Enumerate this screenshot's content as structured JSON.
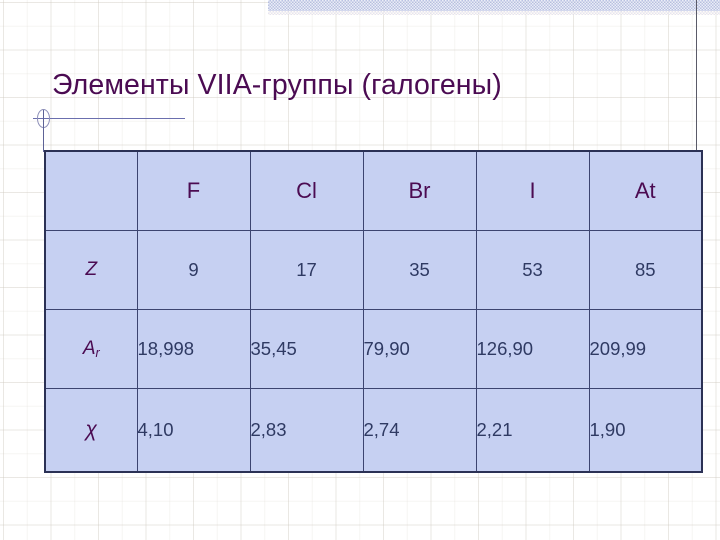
{
  "slide": {
    "title": "Элементы VIIA-группы (галогены)",
    "title_color": "#4b0b52",
    "background": "graph-paper",
    "accent_table_fill": "#c6d0f2",
    "accent_table_border": "#2b3155"
  },
  "decorations": {
    "circle_bullet": "circle-outline-bullet",
    "horizontal_rule": "title-underline-rule",
    "vertical_rule": "connector-rule",
    "top_band": "dithered-band",
    "right_rule": "right-vertical-rule"
  },
  "table": {
    "columns": [
      "",
      "F",
      "Cl",
      "Br",
      "I",
      "At"
    ],
    "rows": [
      {
        "label": "Z",
        "label_sub": "",
        "align": "center",
        "values": [
          "9",
          "17",
          "35",
          "53",
          "85"
        ]
      },
      {
        "label": "A",
        "label_sub": "r",
        "align": "left",
        "values": [
          "18,998",
          "35,45",
          "79,90",
          "126,90",
          "209,99"
        ]
      },
      {
        "label": "χ",
        "label_sub": "",
        "align": "left",
        "values": [
          "4,10",
          "2,83",
          "2,74",
          "2,21",
          "1,90"
        ]
      }
    ]
  },
  "chart_data": {
    "type": "table",
    "title": "Элементы VIIA-группы (галогены)",
    "categories": [
      "F",
      "Cl",
      "Br",
      "I",
      "At"
    ],
    "series": [
      {
        "name": "Z",
        "values": [
          9,
          17,
          35,
          53,
          85
        ]
      },
      {
        "name": "Ar",
        "values": [
          18.998,
          35.45,
          79.9,
          126.9,
          209.99
        ]
      },
      {
        "name": "χ",
        "values": [
          4.1,
          2.83,
          2.74,
          2.21,
          1.9
        ]
      }
    ],
    "xlabel": "",
    "ylabel": "",
    "grid": false,
    "legend": "none"
  }
}
